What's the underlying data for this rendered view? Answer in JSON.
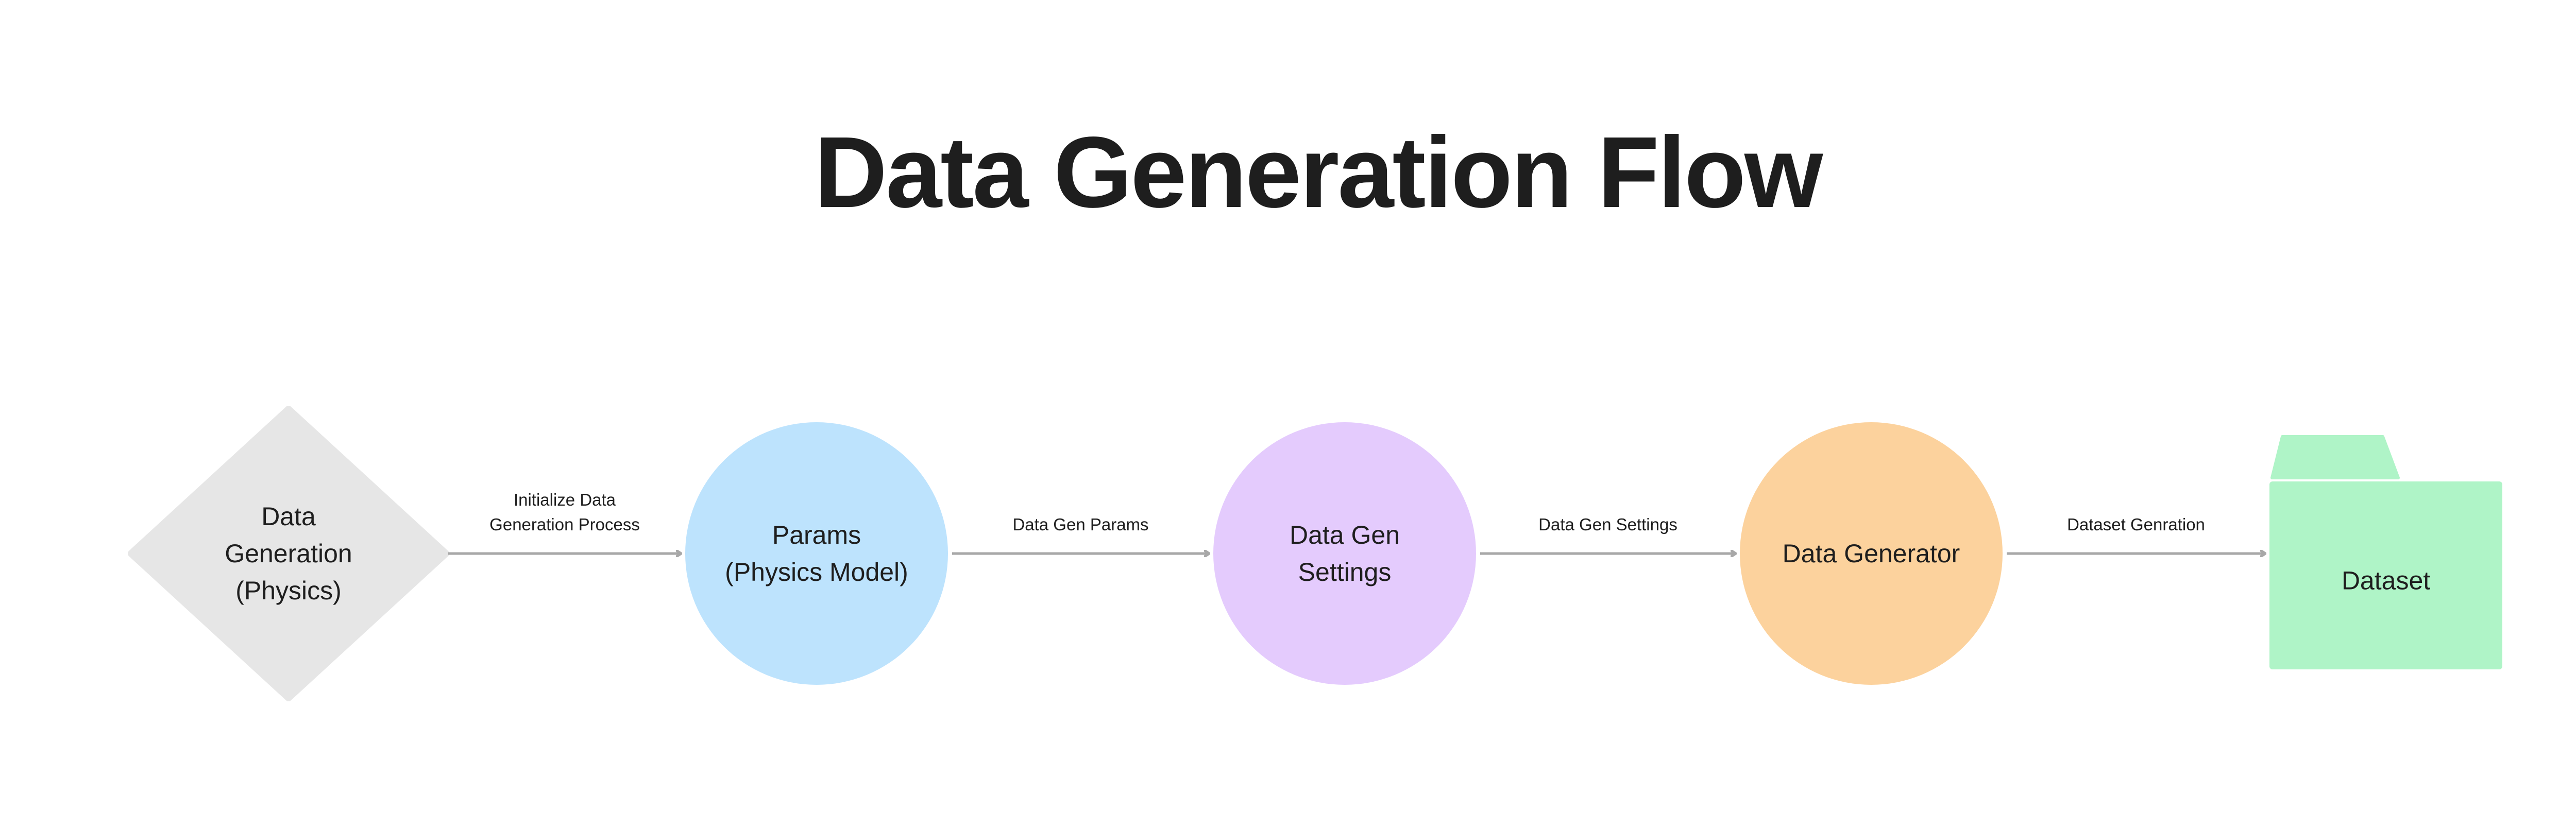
{
  "diagram": {
    "title": "Data Generation Flow",
    "colors": {
      "diamond": "#e6e6e6",
      "params": "#bde3fd",
      "settings": "#e4cbfd",
      "generator": "#fcd29d",
      "dataset": "#aff4c7",
      "dataset_tab": "#aff4c7",
      "arrow": "#a8a8a8",
      "text": "#1e1e1e"
    },
    "nodes": [
      {
        "id": "source",
        "shape": "diamond",
        "lines": [
          "Data",
          "Generation",
          "(Physics)"
        ]
      },
      {
        "id": "params",
        "shape": "circle",
        "lines": [
          "Params",
          "(Physics Model)"
        ]
      },
      {
        "id": "settings",
        "shape": "circle",
        "lines": [
          "Data Gen",
          "Settings"
        ]
      },
      {
        "id": "generator",
        "shape": "circle",
        "lines": [
          "Data Generator"
        ]
      },
      {
        "id": "dataset",
        "shape": "folder",
        "lines": [
          "Dataset"
        ]
      }
    ],
    "edges": [
      {
        "from": "source",
        "to": "params",
        "lines": [
          "Initialize Data",
          "Generation Process"
        ]
      },
      {
        "from": "params",
        "to": "settings",
        "lines": [
          "Data Gen Params"
        ]
      },
      {
        "from": "settings",
        "to": "generator",
        "lines": [
          "Data Gen Settings"
        ]
      },
      {
        "from": "generator",
        "to": "dataset",
        "lines": [
          "Dataset Genration"
        ]
      }
    ]
  }
}
